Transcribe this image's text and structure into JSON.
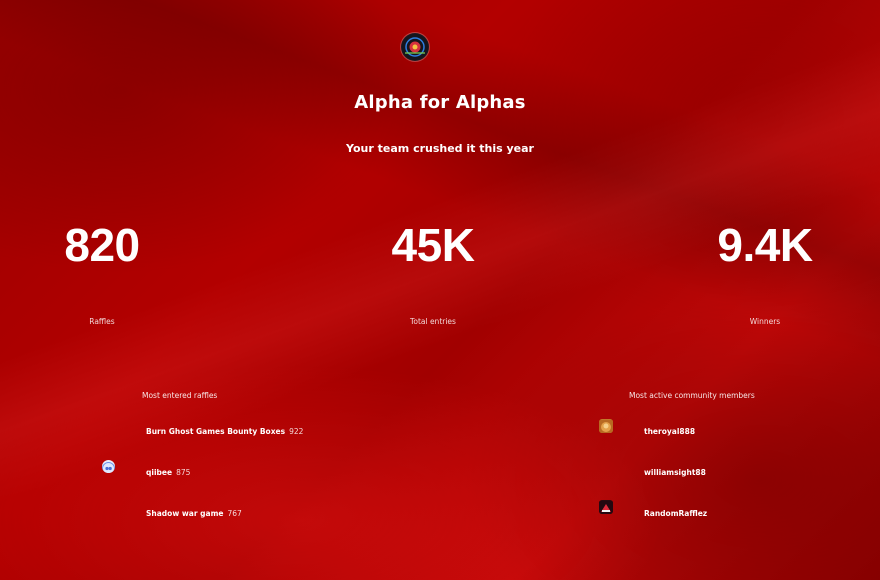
{
  "header": {
    "title": "Alpha for Alphas",
    "subtitle": "Your team crushed it this year"
  },
  "stats": [
    {
      "value": "820",
      "label": "Raffles"
    },
    {
      "value": "45K",
      "label": "Total entries"
    },
    {
      "value": "9.4K",
      "label": "Winners"
    }
  ],
  "most_entered": {
    "heading": "Most entered raffles",
    "items": [
      {
        "name": "Burn Ghost Games Bounty Boxes",
        "count": "922"
      },
      {
        "name": "qiibee",
        "count": "875"
      },
      {
        "name": "Shadow war game",
        "count": "767"
      }
    ]
  },
  "most_active": {
    "heading": "Most active community members",
    "items": [
      {
        "name": "theroyal888"
      },
      {
        "name": "williamsight88"
      },
      {
        "name": "RandomRafflez"
      }
    ]
  },
  "colors": {
    "background": "#b30000",
    "text": "#ffffff"
  }
}
